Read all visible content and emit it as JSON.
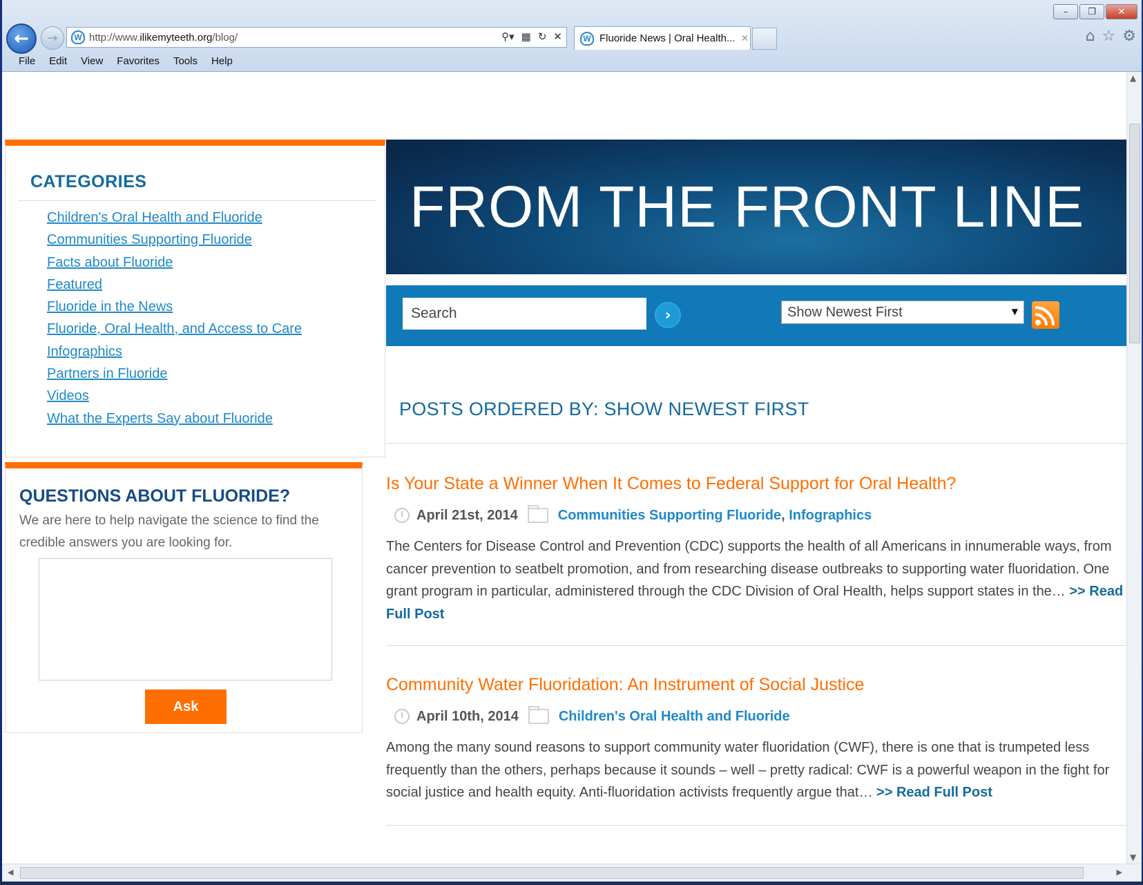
{
  "browser": {
    "url_prefix": "http://www.",
    "url_domain": "ilikemyteeth.org",
    "url_path": "/blog/",
    "tab_title": "Fluoride News | Oral Health...",
    "menu": [
      "File",
      "Edit",
      "View",
      "Favorites",
      "Tools",
      "Help"
    ]
  },
  "sidebar": {
    "categories_title": "CATEGORIES",
    "categories": [
      "Children's Oral Health and Fluoride",
      "Communities Supporting Fluoride",
      "Facts about Fluoride",
      "Featured",
      "Fluoride in the News",
      "Fluoride, Oral Health, and Access to Care",
      "Infographics",
      "Partners in Fluoride",
      "Videos",
      "What the Experts Say about Fluoride"
    ],
    "questions_title": "QUESTIONS ABOUT FLUORIDE?",
    "questions_text": "We are here to help navigate the science to find the credible answers you are looking for.",
    "ask_label": "Ask"
  },
  "hero": {
    "title": "FROM THE FRONT LINE"
  },
  "search": {
    "placeholder": "Search",
    "sort_value": "Show Newest First"
  },
  "main": {
    "ordered_heading": "POSTS ORDERED BY: SHOW NEWEST FIRST",
    "read_more": ">> Read Full Post",
    "posts": [
      {
        "title": "Is Your State a Winner When It Comes to Federal Support for Oral Health?",
        "date": "April 21st, 2014",
        "cat1": "Communities Supporting Fluoride",
        "sep": ",",
        "cat2": "Infographics",
        "body": "The Centers for Disease Control and Prevention (CDC) supports the health of all Americans in innumerable ways, from cancer prevention to seatbelt promotion, and from researching disease outbreaks to supporting water fluoridation. One grant program in particular, administered through the CDC Division of Oral Health, helps support states in the…"
      },
      {
        "title": "Community Water Fluoridation: An Instrument of Social Justice",
        "date": "April 10th, 2014",
        "cat1": "Children's Oral Health and Fluoride",
        "body": "Among the many sound reasons to support community water fluoridation (CWF), there is one that is trumpeted less frequently than the others, perhaps because it sounds – well – pretty radical: CWF is a powerful weapon in the fight for social justice and health equity. Anti-fluoridation activists frequently argue that…"
      }
    ]
  },
  "icons": {
    "back": "arrow-left-icon",
    "forward": "arrow-right-icon",
    "home": "home-icon",
    "favorites": "star-icon",
    "tools": "gear-icon",
    "rss": "rss-icon"
  },
  "colors": {
    "accent_orange": "#ff6e00",
    "heading_blue": "#136a9c",
    "link_blue": "#1f89c8",
    "search_bar_blue": "#1179b7"
  }
}
